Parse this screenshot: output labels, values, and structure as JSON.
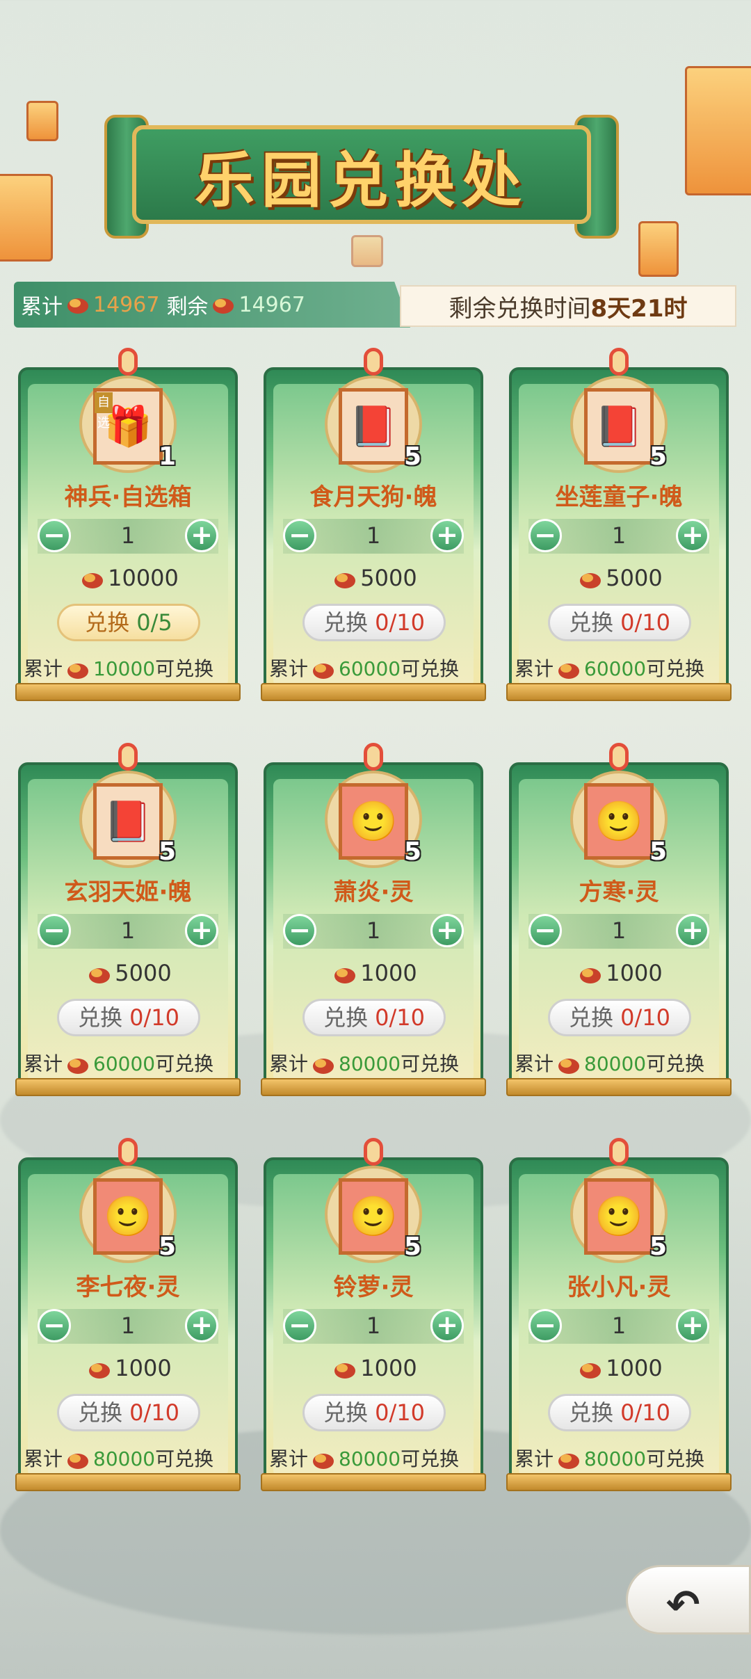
{
  "header": {
    "title": "乐园兑换处"
  },
  "stats": {
    "total_label": "累计",
    "total_value": "14967",
    "remain_label": "剩余",
    "remain_value": "14967"
  },
  "timer": {
    "label": "剩余兑换时间",
    "value": "8天21时"
  },
  "common": {
    "exchange_label": "兑换",
    "cumulative_label": "累计",
    "can_exchange_label": "可兑换",
    "minus": "−",
    "plus": "+"
  },
  "items": [
    {
      "name": "神兵·自选箱",
      "count": "1",
      "qty": "1",
      "price": "10000",
      "exchange_progress": "0/5",
      "requirement": "10000",
      "active": true,
      "tag": "自选",
      "icon": "chest-icon"
    },
    {
      "name": "食月天狗·魄",
      "count": "5",
      "qty": "1",
      "price": "5000",
      "exchange_progress": "0/10",
      "requirement": "60000",
      "active": false,
      "tag": "",
      "icon": "book-icon"
    },
    {
      "name": "坐莲童子·魄",
      "count": "5",
      "qty": "1",
      "price": "5000",
      "exchange_progress": "0/10",
      "requirement": "60000",
      "active": false,
      "tag": "",
      "icon": "book-icon"
    },
    {
      "name": "玄羽天姬·魄",
      "count": "5",
      "qty": "1",
      "price": "5000",
      "exchange_progress": "0/10",
      "requirement": "60000",
      "active": false,
      "tag": "",
      "icon": "book-icon"
    },
    {
      "name": "萧炎·灵",
      "count": "5",
      "qty": "1",
      "price": "1000",
      "exchange_progress": "0/10",
      "requirement": "80000",
      "active": false,
      "tag": "",
      "icon": "portrait-icon"
    },
    {
      "name": "方寒·灵",
      "count": "5",
      "qty": "1",
      "price": "1000",
      "exchange_progress": "0/10",
      "requirement": "80000",
      "active": false,
      "tag": "",
      "icon": "portrait-icon"
    },
    {
      "name": "李七夜·灵",
      "count": "5",
      "qty": "1",
      "price": "1000",
      "exchange_progress": "0/10",
      "requirement": "80000",
      "active": false,
      "tag": "",
      "icon": "portrait-icon"
    },
    {
      "name": "铃萝·灵",
      "count": "5",
      "qty": "1",
      "price": "1000",
      "exchange_progress": "0/10",
      "requirement": "80000",
      "active": false,
      "tag": "",
      "icon": "portrait-icon"
    },
    {
      "name": "张小凡·灵",
      "count": "5",
      "qty": "1",
      "price": "1000",
      "exchange_progress": "0/10",
      "requirement": "80000",
      "active": false,
      "tag": "",
      "icon": "portrait-icon"
    }
  ],
  "back_button": {
    "icon": "back-arrow-icon"
  }
}
